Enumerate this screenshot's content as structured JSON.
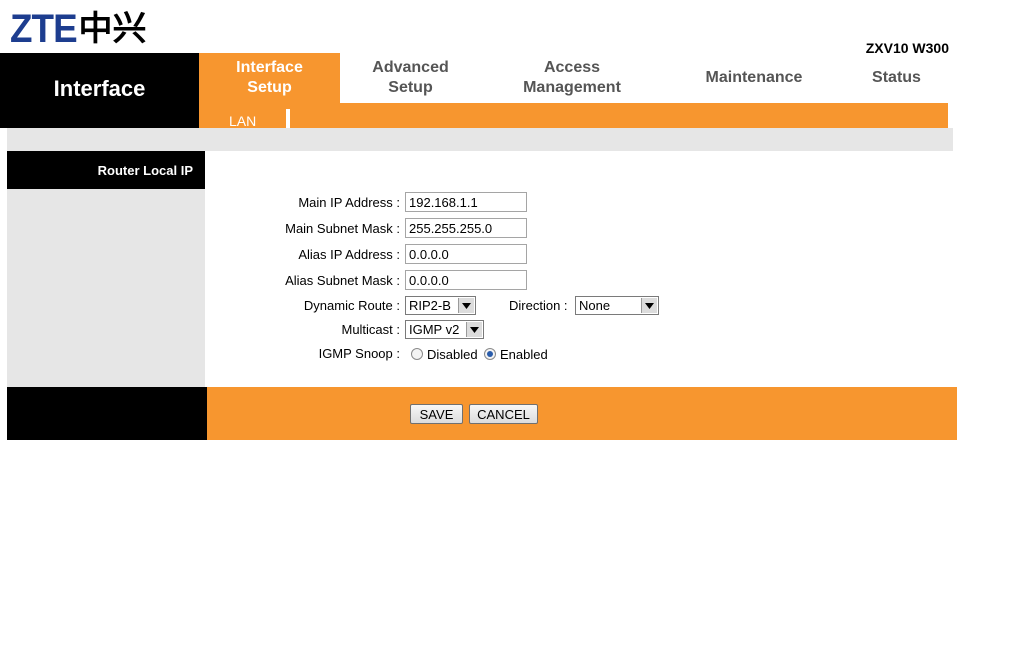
{
  "brand": {
    "logo_latin": "ZTE",
    "logo_cjk": "中兴",
    "model": "ZXV10 W300"
  },
  "nav": {
    "section": "Interface",
    "tabs": [
      {
        "line1": "Interface",
        "line2": "Setup",
        "active": true
      },
      {
        "line1": "Advanced",
        "line2": "Setup",
        "active": false
      },
      {
        "line1": "Access",
        "line2": "Management",
        "active": false
      },
      {
        "line1": "Maintenance",
        "line2": "",
        "active": false
      },
      {
        "line1": "Status",
        "line2": "",
        "active": false
      }
    ],
    "subtab": "LAN"
  },
  "section_title": "Router Local IP",
  "form": {
    "main_ip_label": "Main IP Address :",
    "main_ip_value": "192.168.1.1",
    "main_subnet_label": "Main Subnet Mask :",
    "main_subnet_value": "255.255.255.0",
    "alias_ip_label": "Alias IP Address :",
    "alias_ip_value": "0.0.0.0",
    "alias_subnet_label": "Alias Subnet Mask :",
    "alias_subnet_value": "0.0.0.0",
    "dynamic_route_label": "Dynamic Route :",
    "dynamic_route_value": "RIP2-B",
    "direction_label": "Direction :",
    "direction_value": "None",
    "multicast_label": "Multicast :",
    "multicast_value": "IGMP v2",
    "igmp_snoop_label": "IGMP Snoop :",
    "igmp_disabled": "Disabled",
    "igmp_enabled": "Enabled"
  },
  "buttons": {
    "save": "SAVE",
    "cancel": "CANCEL"
  },
  "colors": {
    "accent": "#f7962f",
    "dark": "#000000",
    "panel_gray": "#e6e6e6",
    "logo_blue": "#1d3d8f"
  }
}
